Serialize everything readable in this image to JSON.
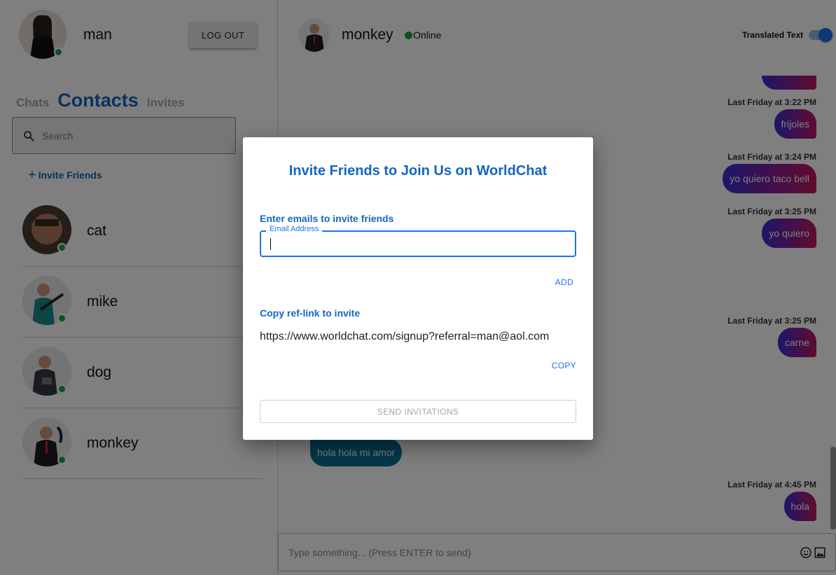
{
  "colors": {
    "accent": "#1565c0",
    "online": "#16a34a",
    "outgoing_bubble_start": "#3b2bd6",
    "outgoing_bubble_end": "#c2185b",
    "incoming_bubble": "#0a6f96"
  },
  "sidebar": {
    "user_name": "man",
    "logout_label": "LOG OUT",
    "tabs": [
      {
        "label": "Chats",
        "active": false
      },
      {
        "label": "Contacts",
        "active": true
      },
      {
        "label": "Invites",
        "active": false
      }
    ],
    "search_placeholder": "Search",
    "invite_friends_label": "Invite Friends",
    "contacts": [
      {
        "name": "cat",
        "online": true
      },
      {
        "name": "mike",
        "online": true
      },
      {
        "name": "dog",
        "online": true
      },
      {
        "name": "monkey",
        "online": true
      }
    ]
  },
  "chat": {
    "peer_name": "monkey",
    "peer_status": "Online",
    "translated_text_label": "Translated Text",
    "translated_text_on": true,
    "messages": [
      {
        "timestamp": "Last Friday at 3:22 PM",
        "text": "frijoles"
      },
      {
        "timestamp": "Last Friday at 3:24 PM",
        "text": "yo quiero taco bell"
      },
      {
        "timestamp": "Last Friday at 3:25 PM",
        "text": "yo quiero"
      },
      {
        "timestamp": "Last Friday at 3:25 PM",
        "text": "carne"
      },
      {
        "text": "hola hola mi amor"
      },
      {
        "timestamp": "Last Friday at 4:45 PM",
        "text": "hola"
      }
    ],
    "composer_placeholder": "Type something... (Press ENTER to send)"
  },
  "modal": {
    "title": "Invite Friends to Join Us on WorldChat",
    "emails_label": "Enter emails to invite friends",
    "email_field_label": "Email Address",
    "email_value": "",
    "add_label": "ADD",
    "reflink_label": "Copy ref-link to invite",
    "reflink_value": "https://www.worldchat.com/signup?referral=man@aol.com",
    "copy_label": "COPY",
    "send_label": "SEND INVITATIONS"
  }
}
